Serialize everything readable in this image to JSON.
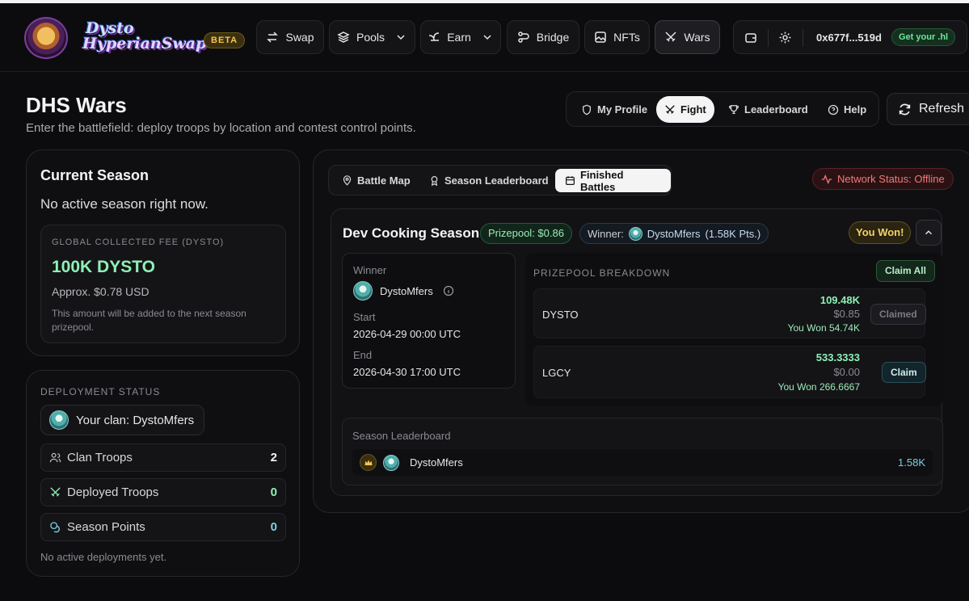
{
  "header": {
    "brand_line1": "Dysto",
    "brand_line2": "HyperianSwap",
    "beta": "BETA",
    "nav": [
      {
        "label": "Swap",
        "icon": "swap-arrows-icon"
      },
      {
        "label": "Pools",
        "icon": "layers-icon",
        "dropdown": true
      },
      {
        "label": "Earn",
        "icon": "sprout-icon",
        "dropdown": true
      },
      {
        "label": "Bridge",
        "icon": "bridge-icon"
      },
      {
        "label": "NFTs",
        "icon": "image-icon"
      },
      {
        "label": "Wars",
        "icon": "crossed-swords-icon",
        "active": true
      }
    ],
    "wallet": {
      "address": "0x677f...519d",
      "get_name": "Get your .hl"
    }
  },
  "page": {
    "title": "DHS Wars",
    "subtitle": "Enter the battlefield: deploy troops by location and contest control points."
  },
  "tabs": [
    {
      "label": "My Profile",
      "icon": "shield-icon"
    },
    {
      "label": "Fight",
      "icon": "crossed-swords-icon",
      "active": true
    },
    {
      "label": "Leaderboard",
      "icon": "trophy-icon"
    },
    {
      "label": "Help",
      "icon": "help-circle-icon"
    }
  ],
  "refresh_label": "Refresh",
  "season": {
    "title": "Current Season",
    "message": "No active season right now.",
    "fee_label": "GLOBAL COLLECTED FEE (DYSTO)",
    "fee_value": "100K DYSTO",
    "fee_usd": "Approx. $0.78 USD",
    "fee_note": "This amount will be added to the next season prizepool."
  },
  "deployment": {
    "label": "DEPLOYMENT STATUS",
    "clan": "Your clan: DystoMfers",
    "stats": [
      {
        "label": "Clan Troops",
        "value": "2",
        "icon": "users-icon",
        "color": "#f4f4f5"
      },
      {
        "label": "Deployed Troops",
        "value": "0",
        "icon": "crossed-swords-icon",
        "color": "#8ff0b5"
      },
      {
        "label": "Season Points",
        "value": "0",
        "icon": "coins-icon",
        "color": "#7ad0e0"
      }
    ],
    "footer": "No active deployments yet."
  },
  "subtabs": [
    {
      "label": "Battle Map",
      "icon": "map-pin-icon"
    },
    {
      "label": "Season Leaderboard",
      "icon": "award-icon"
    },
    {
      "label": "Finished Battles",
      "icon": "calendar-icon",
      "active": true
    }
  ],
  "network_status": "Network Status: Offline",
  "battle": {
    "title": "Dev Cooking Season",
    "prizepool": "Prizepool: $0.86",
    "winner_label": "Winner:",
    "winner_name": "DystoMfers",
    "winner_pts": "(1.58K Pts.)",
    "you_won": "You Won!",
    "details": {
      "winner_key": "Winner",
      "winner_value": "DystoMfers",
      "start_key": "Start",
      "start_value": "2026-04-29 00:00 UTC",
      "end_key": "End",
      "end_value": "2026-04-30 17:00 UTC"
    },
    "breakdown": {
      "label": "PRIZEPOOL BREAKDOWN",
      "claim_all": "Claim All",
      "tokens": [
        {
          "name": "DYSTO",
          "amount": "109.48K",
          "usd": "$0.85",
          "won": "You Won 54.74K",
          "button": "Claimed",
          "state": "claimed"
        },
        {
          "name": "LGCY",
          "amount": "533.3333",
          "usd": "$0.00",
          "won": "You Won 266.6667",
          "button": "Claim",
          "state": "claim"
        }
      ]
    },
    "leaderboard": {
      "label": "Season Leaderboard",
      "rows": [
        {
          "name": "DystoMfers",
          "points": "1.58K"
        }
      ]
    }
  }
}
